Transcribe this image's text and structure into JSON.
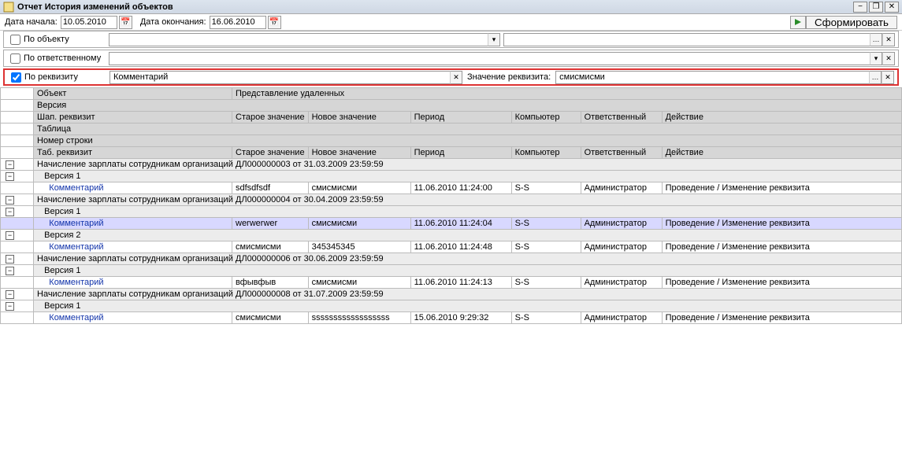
{
  "titlebar": {
    "title": "Отчет  История изменений объектов",
    "min": "−",
    "restore": "❐",
    "close": "✕"
  },
  "top": {
    "date_from_label": "Дата начала:",
    "date_from": "10.05.2010",
    "date_to_label": "Дата окончания:",
    "date_to": "16.06.2010",
    "generate": "Сформировать"
  },
  "filters": {
    "by_object": {
      "label": "По объекту",
      "checked": false,
      "value1": "",
      "value2": ""
    },
    "by_responsible": {
      "label": "По ответственному",
      "checked": false,
      "value": ""
    },
    "by_attr": {
      "label": "По реквизиту",
      "checked": true,
      "attr": "Комментарий",
      "value_label": "Значение реквизита:",
      "value": "смисмисми"
    }
  },
  "headers": {
    "object": "Объект",
    "deleted_repr": "Представление удаленных",
    "version": "Версия",
    "shap_rekv": "Шап. реквизит",
    "old": "Старое значение",
    "new": "Новое значение",
    "period": "Период",
    "computer": "Компьютер",
    "responsible": "Ответственный",
    "action": "Действие",
    "table": "Таблица",
    "rownum": "Номер строки",
    "tab_rekv": "Таб. реквизит"
  },
  "groups": [
    {
      "title": "Начисление зарплаты сотрудникам организаций ДЛ000000003 от 31.03.2009 23:59:59",
      "versions": [
        {
          "label": "Версия 1",
          "rows": [
            {
              "rekv": "Комментарий",
              "old": "sdfsdfsdf",
              "new": "смисмисми",
              "period": "11.06.2010 11:24:00",
              "comp": "S-S",
              "resp": "Администратор",
              "act": "Проведение / Изменение реквизита"
            }
          ]
        }
      ]
    },
    {
      "title": "Начисление зарплаты сотрудникам организаций ДЛ000000004 от 30.04.2009 23:59:59",
      "versions": [
        {
          "label": "Версия 1",
          "selected": true,
          "rows": [
            {
              "rekv": "Комментарий",
              "old": "werwerwer",
              "new": "смисмисми",
              "period": "11.06.2010 11:24:04",
              "comp": "S-S",
              "resp": "Администратор",
              "act": "Проведение / Изменение реквизита",
              "selected": true
            }
          ]
        },
        {
          "label": "Версия 2",
          "rows": [
            {
              "rekv": "Комментарий",
              "old": "смисмисми",
              "new": "345345345",
              "period": "11.06.2010 11:24:48",
              "comp": "S-S",
              "resp": "Администратор",
              "act": "Проведение / Изменение реквизита"
            }
          ]
        }
      ]
    },
    {
      "title": "Начисление зарплаты сотрудникам организаций ДЛ000000006 от 30.06.2009 23:59:59",
      "versions": [
        {
          "label": "Версия 1",
          "rows": [
            {
              "rekv": "Комментарий",
              "old": "вфывфыв",
              "new": "смисмисми",
              "period": "11.06.2010 11:24:13",
              "comp": "S-S",
              "resp": "Администратор",
              "act": "Проведение / Изменение реквизита"
            }
          ]
        }
      ]
    },
    {
      "title": "Начисление зарплаты сотрудникам организаций ДЛ000000008 от 31.07.2009 23:59:59",
      "versions": [
        {
          "label": "Версия 1",
          "rows": [
            {
              "rekv": "Комментарий",
              "old": "смисмисми",
              "new": "ssssssssssssssssss",
              "period": "15.06.2010 9:29:32",
              "comp": "S-S",
              "resp": "Администратор",
              "act": "Проведение / Изменение реквизита"
            }
          ]
        }
      ]
    }
  ]
}
